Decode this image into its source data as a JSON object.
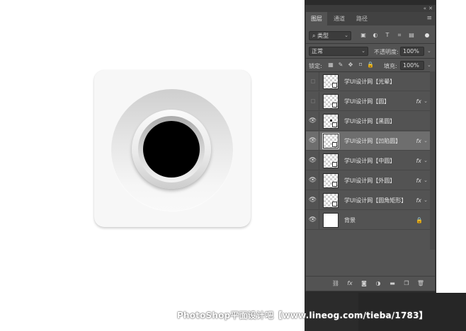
{
  "panel": {
    "tabs": [
      {
        "label": "图层",
        "active": true
      },
      {
        "label": "通道",
        "active": false
      },
      {
        "label": "路径",
        "active": false
      }
    ],
    "collapse_icon": "collapse-double-arrow-icon",
    "close_icon": "close-x-icon",
    "menu_icon": "panel-menu-icon",
    "filter_label": "类型",
    "filter_icons": [
      "image-filter-icon",
      "adjustment-filter-icon",
      "text-filter-icon",
      "shape-filter-icon",
      "smart-object-filter-icon"
    ],
    "blend_mode": "正常",
    "opacity_label": "不透明度:",
    "opacity_value": "100%",
    "lock_label": "锁定:",
    "lock_icons": [
      "lock-transparent-icon",
      "lock-pixels-icon",
      "lock-position-icon",
      "lock-artboard-icon",
      "lock-all-icon"
    ],
    "fill_label": "填充:",
    "fill_value": "100%",
    "fx_label": "fx",
    "layers": [
      {
        "name": "学UI设计网【光晕】",
        "visible": false,
        "fx": false,
        "thumb": "checker"
      },
      {
        "name": "学UI设计网【圆】",
        "visible": false,
        "fx": true,
        "thumb": "checker"
      },
      {
        "name": "学UI设计网【黑圆】",
        "visible": true,
        "fx": false,
        "thumb": "checker-dot"
      },
      {
        "name": "学UI设计网【凹陷圆】",
        "visible": true,
        "fx": true,
        "thumb": "checker",
        "selected": true
      },
      {
        "name": "学UI设计网【中圆】",
        "visible": true,
        "fx": true,
        "thumb": "checker"
      },
      {
        "name": "学UI设计网【外圆】",
        "visible": true,
        "fx": true,
        "thumb": "checker"
      },
      {
        "name": "学UI设计网【圆角矩形】",
        "visible": true,
        "fx": true,
        "thumb": "checker"
      },
      {
        "name": "背景",
        "visible": true,
        "fx": false,
        "thumb": "white",
        "locked": true
      }
    ],
    "footer_icons": [
      "link-layers-icon",
      "fx-icon",
      "layer-mask-icon",
      "adjustment-layer-icon",
      "new-group-icon",
      "new-layer-icon",
      "trash-icon"
    ]
  },
  "watermark": "PhotoShop平面设计吧【www.lineog.com/tieba/1783】",
  "colors": {
    "panel_bg": "#535353",
    "selected_row": "#6e6e6e",
    "core_black": "#000000",
    "tile": "#f7f7f7"
  }
}
